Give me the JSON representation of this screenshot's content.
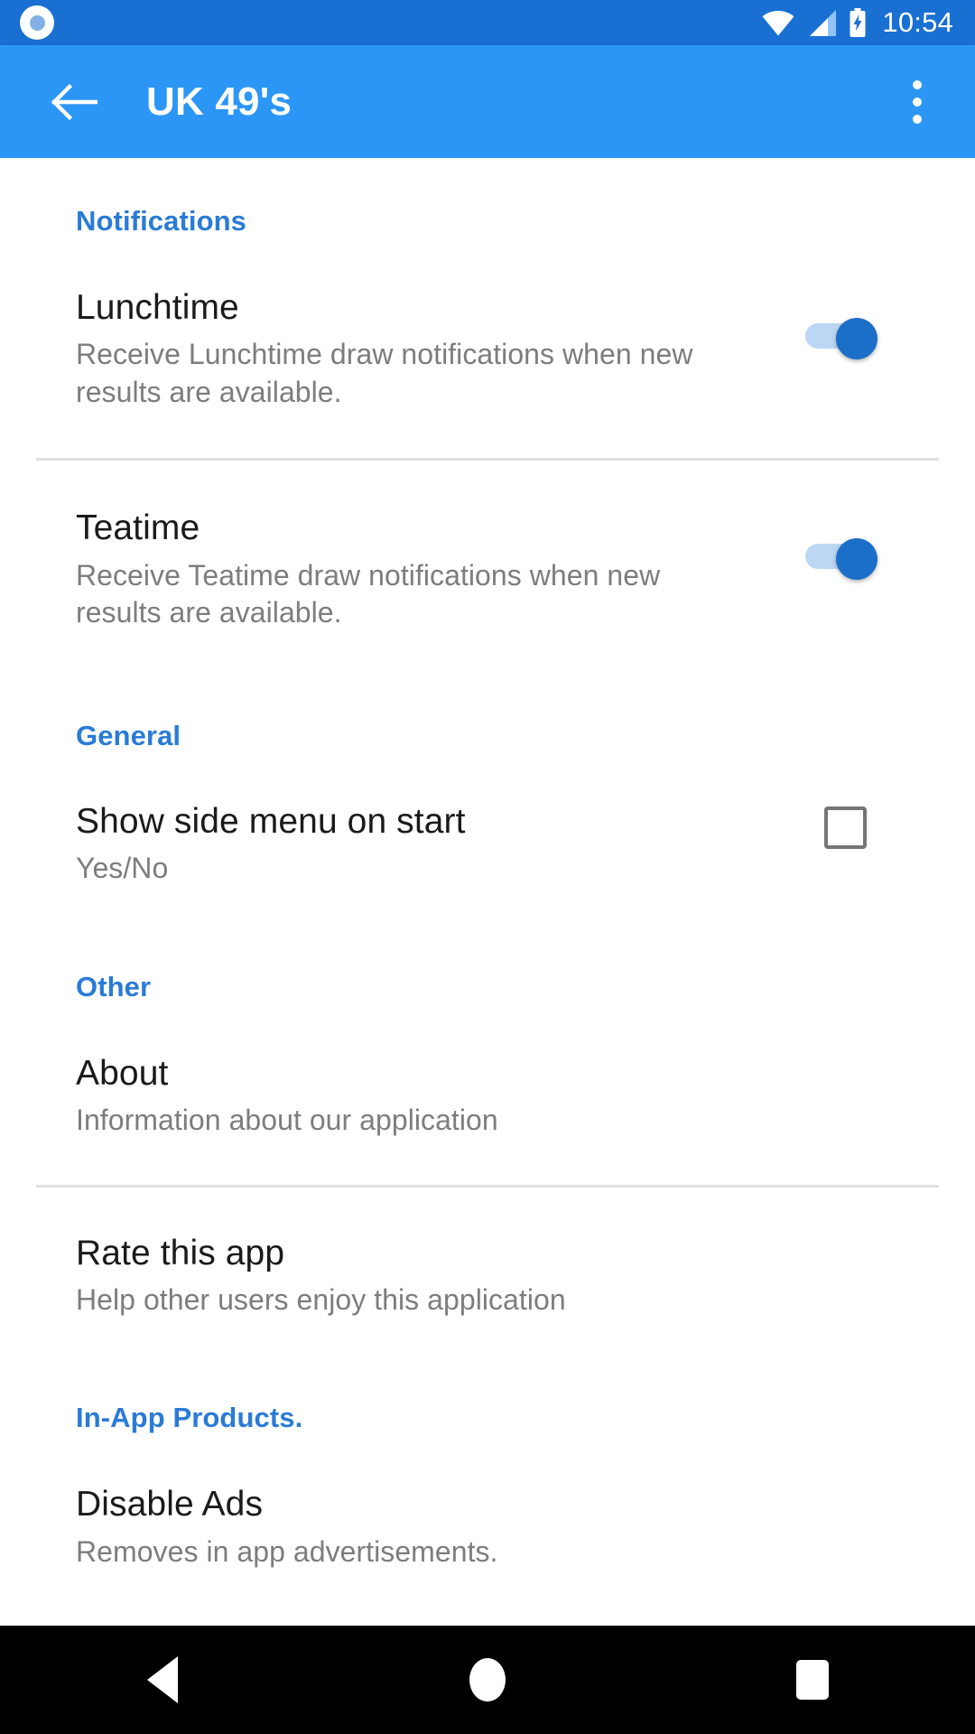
{
  "status_bar": {
    "notification_icon": "app-notification-icon",
    "wifi_icon": "wifi-icon",
    "signal_icon": "cell-signal-icon",
    "battery_icon": "battery-charging-icon",
    "clock": "10:54",
    "background_color": "#1970D2"
  },
  "app_bar": {
    "back_icon": "back-arrow-icon",
    "title": "UK 49's",
    "overflow_icon": "overflow-menu-icon",
    "background_color": "#2B96F5"
  },
  "sections": [
    {
      "header": "Notifications",
      "items": [
        {
          "title": "Lunchtime",
          "summary": "Receive Lunchtime draw notifications when new results are available.",
          "widget": "switch",
          "checked": true
        },
        {
          "title": "Teatime",
          "summary": "Receive Teatime draw notifications when new results are available.",
          "widget": "switch",
          "checked": true
        }
      ]
    },
    {
      "header": "General",
      "items": [
        {
          "title": "Show side menu on start",
          "summary": "Yes/No",
          "widget": "checkbox",
          "checked": false
        }
      ]
    },
    {
      "header": "Other",
      "items": [
        {
          "title": "About",
          "summary": "Information about our application",
          "widget": "none"
        },
        {
          "title": "Rate this app",
          "summary": "Help other users enjoy this application",
          "widget": "none"
        }
      ]
    },
    {
      "header": "In-App Products.",
      "items": [
        {
          "title": "Disable Ads",
          "summary": "Removes in app advertisements.",
          "widget": "none"
        }
      ]
    }
  ],
  "nav_bar": {
    "back_icon": "nav-back-triangle-icon",
    "home_icon": "nav-home-circle-icon",
    "recents_icon": "nav-recents-square-icon",
    "background_color": "#000000"
  },
  "colors": {
    "section_header": "#2A7BD6",
    "switch_on_thumb": "#1B6FC9",
    "switch_on_track": "#BBD7F4",
    "title_text": "#1a1a1a",
    "summary_text": "#7d7d7d",
    "divider": "#e0e0e0"
  }
}
